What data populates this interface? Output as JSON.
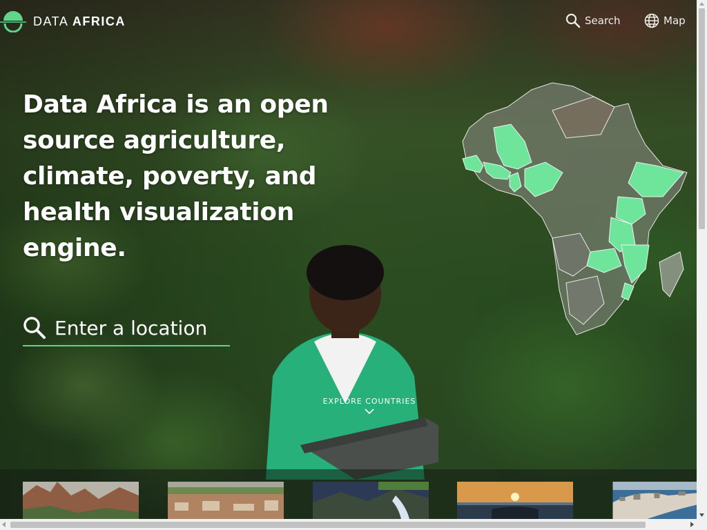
{
  "header": {
    "logo_text_light": "DATA",
    "logo_text_bold": "AFRICA",
    "logo_icon": "data-africa-logo",
    "search_label": "Search",
    "search_icon": "search-icon",
    "map_label": "Map",
    "map_icon": "globe-icon"
  },
  "hero": {
    "headline": "Data Africa is an open source agriculture, climate, poverty, and health visualization engine.",
    "search_placeholder": "Enter a location",
    "search_icon": "search-icon",
    "explore_label": "EXPLORE COUNTRIES",
    "explore_icon": "chevron-down-icon"
  },
  "map": {
    "highlight_color": "#6ee59a",
    "region_color": "#8a8a86",
    "border_color": "#ffffff"
  },
  "thumbnails": [
    {
      "name": "country-thumbnail-1"
    },
    {
      "name": "country-thumbnail-2"
    },
    {
      "name": "country-thumbnail-3"
    },
    {
      "name": "country-thumbnail-4"
    },
    {
      "name": "country-thumbnail-5"
    }
  ],
  "colors": {
    "accent": "#5fd68b",
    "text": "#ffffff"
  }
}
